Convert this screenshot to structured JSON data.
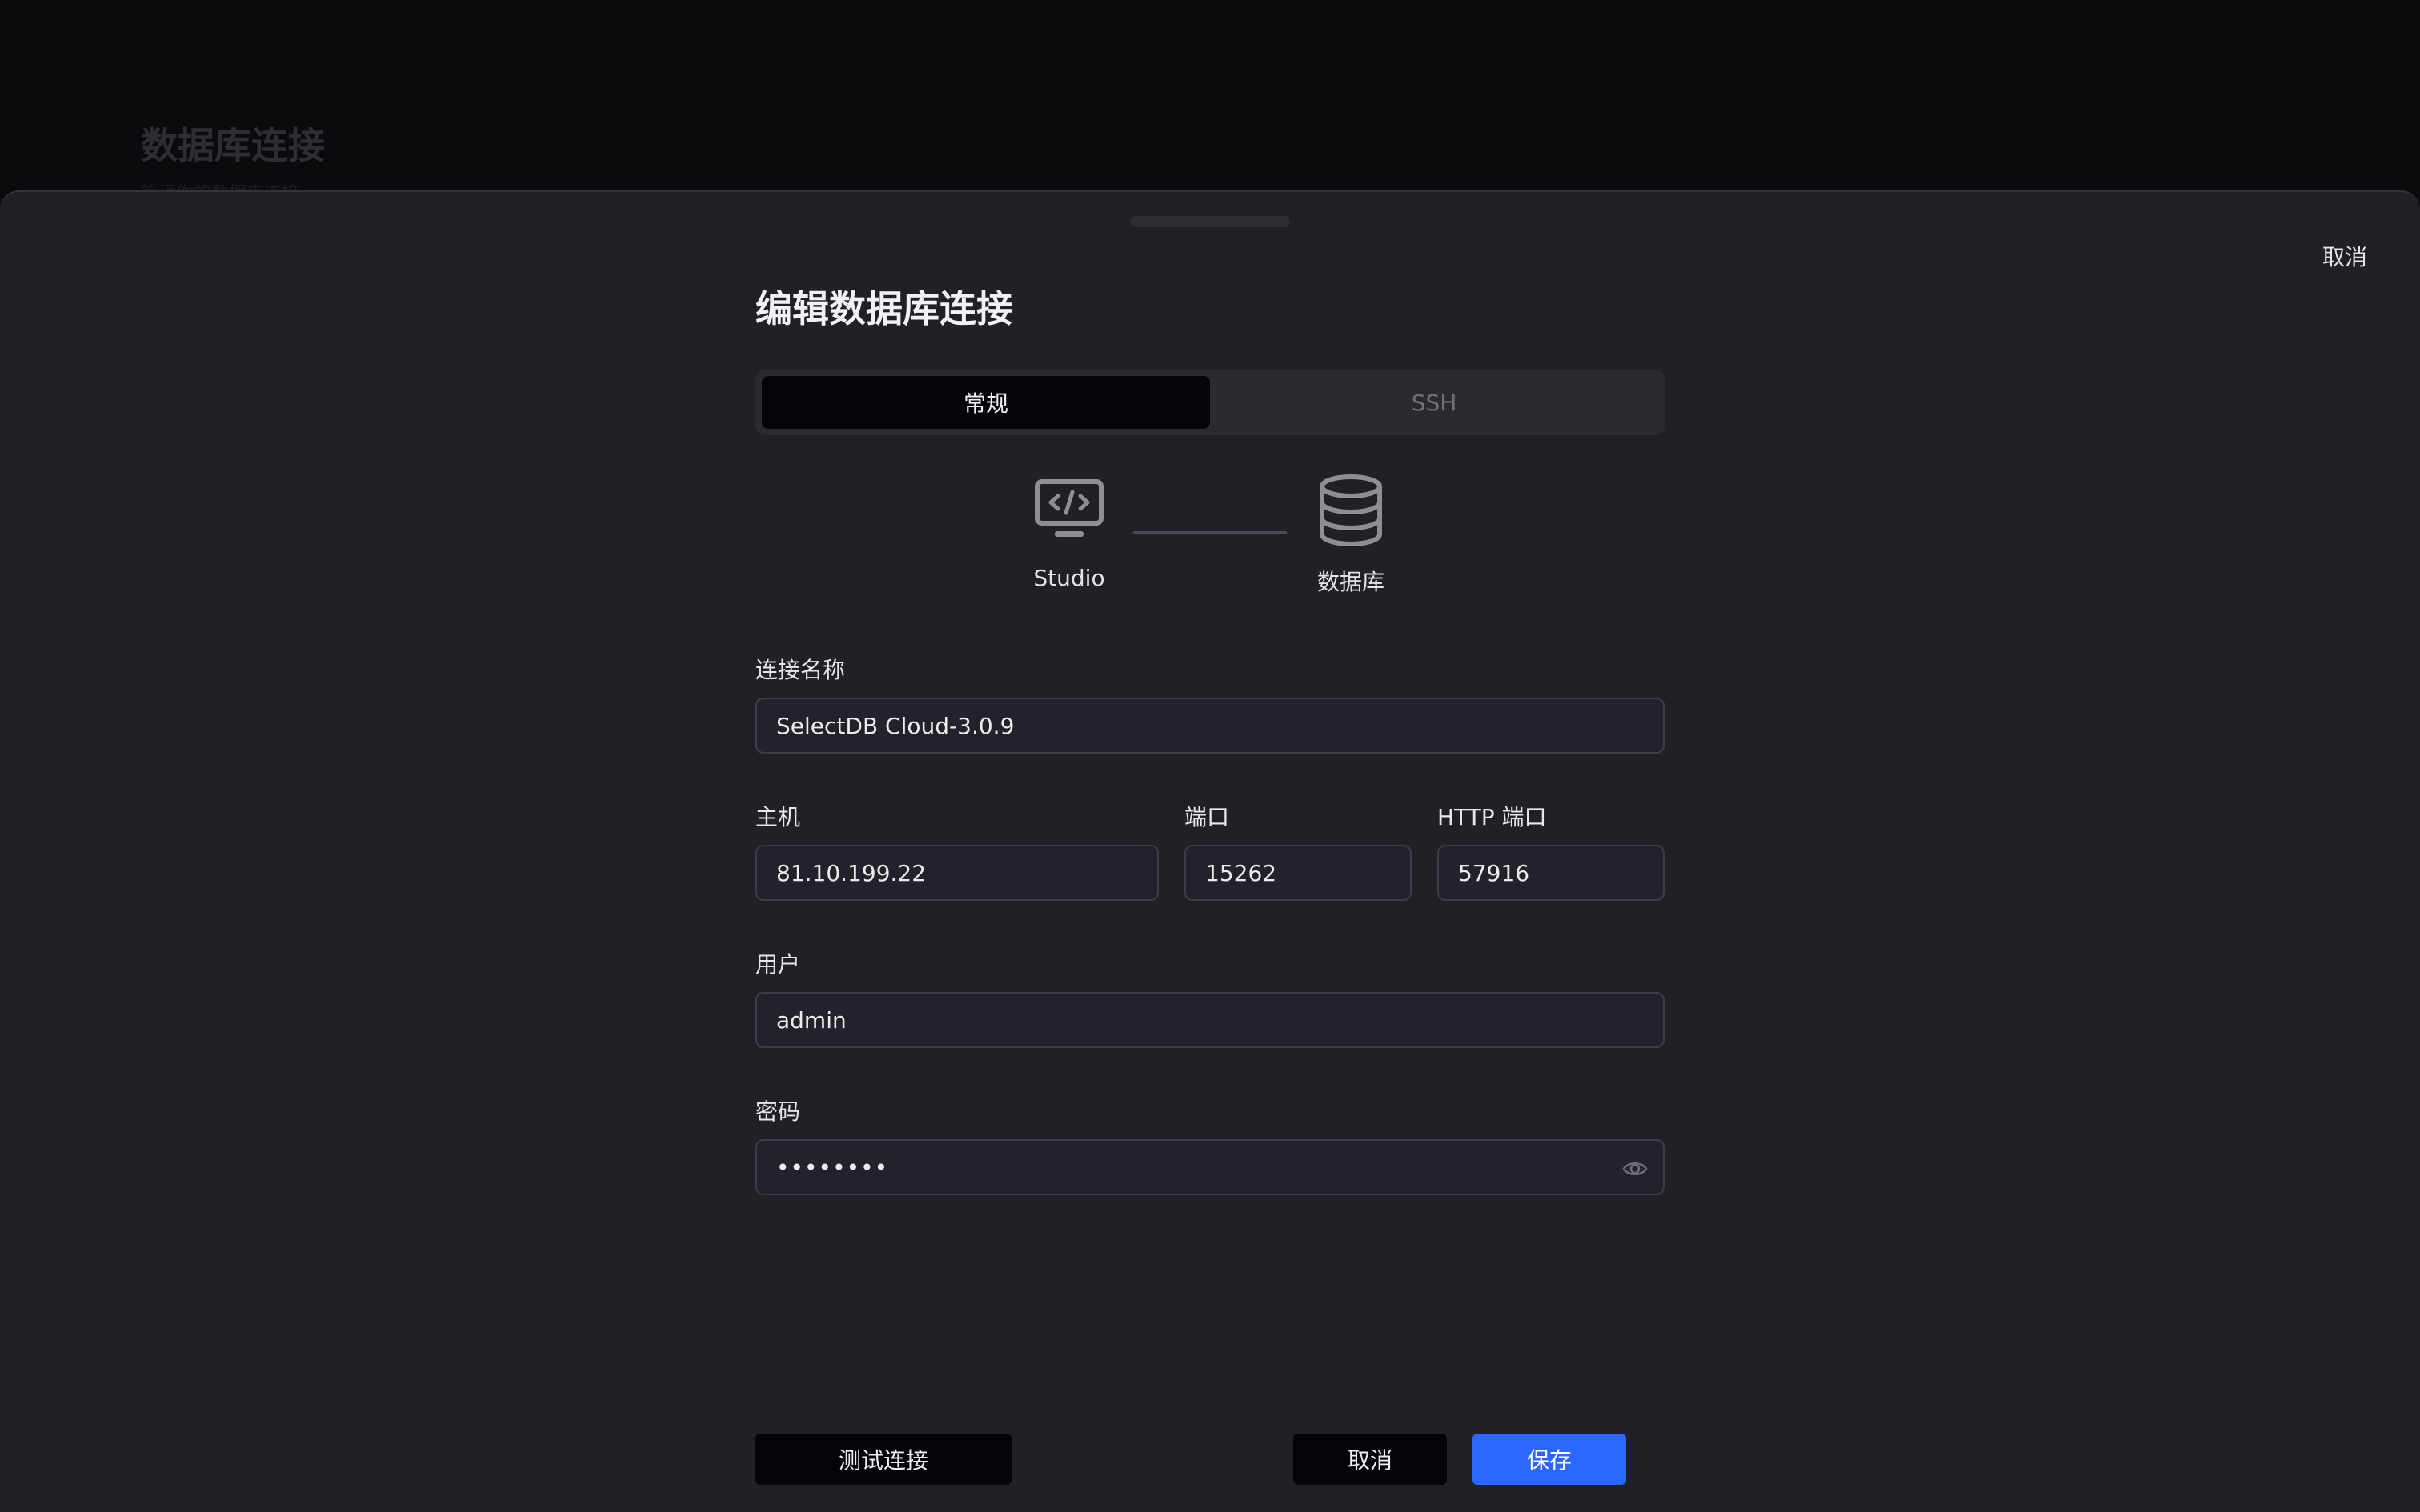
{
  "background": {
    "title": "数据库连接",
    "subtitle": "管理你的数据库连接"
  },
  "sheet": {
    "cancel_label": "取消"
  },
  "form": {
    "title": "编辑数据库连接",
    "tabs": [
      {
        "label": "常规",
        "active": true
      },
      {
        "label": "SSH",
        "active": false
      }
    ],
    "diagram": {
      "left_label": "Studio",
      "right_label": "数据库",
      "left_icon": "monitor-code-icon",
      "right_icon": "database-icon"
    },
    "connection_name": {
      "label": "连接名称",
      "value": "SelectDB Cloud-3.0.9"
    },
    "host": {
      "label": "主机",
      "value": "81.10.199.22"
    },
    "port": {
      "label": "端口",
      "value": "15262"
    },
    "http_port": {
      "label": "HTTP 端口",
      "value": "57916"
    },
    "user": {
      "label": "用户",
      "value": "admin"
    },
    "password": {
      "label": "密码",
      "value": "••••••••",
      "toggle_icon": "eye-icon"
    }
  },
  "footer": {
    "test_label": "测试连接",
    "cancel_label": "取消",
    "save_label": "保存"
  },
  "colors": {
    "primary": "#2b66ff",
    "sheet_bg": "#202127",
    "backdrop": "#0b0b0e"
  }
}
